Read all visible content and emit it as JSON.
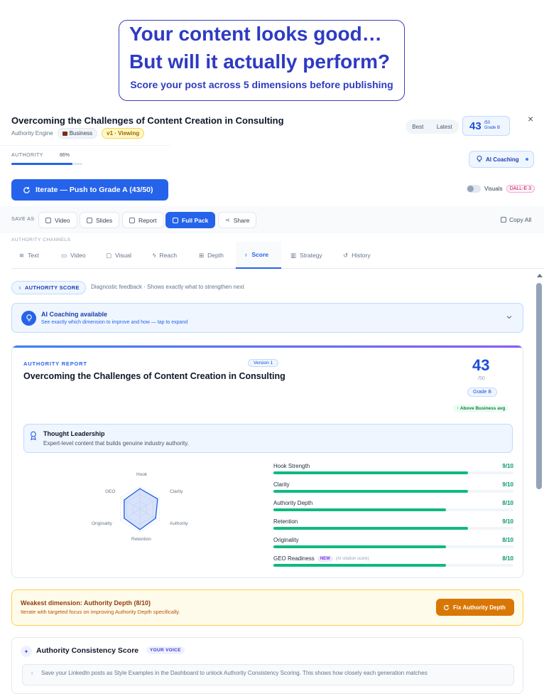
{
  "promo": {
    "line1": "Your content looks good…",
    "line2": "But will it actually perform?",
    "sub": "Score your post across 5 dimensions before publishing"
  },
  "header": {
    "title": "Overcoming the Challenges of Content Creation in Consulting",
    "engine": "Authority Engine",
    "category": "Business",
    "version_badge": "v1 · Viewing",
    "seg_best": "Best",
    "seg_latest": "Latest",
    "score": "43",
    "score_of": "/50",
    "grade": "Grade B",
    "close": "×"
  },
  "authority": {
    "label": "AUTHORITY",
    "percent": "86%",
    "fill_fraction": 0.86
  },
  "ai_coaching_button": "AI Coaching",
  "iterate_button": "Iterate — Push to Grade A (43/50)",
  "visuals": {
    "label": "Visuals",
    "badge": "DALL-E 3"
  },
  "save_as": {
    "label": "SAVE AS",
    "buttons": [
      "Video",
      "Slides",
      "Report",
      "Full Pack",
      "Share"
    ],
    "copy_all": "Copy All"
  },
  "channels": {
    "label": "AUTHORITY CHANNELS",
    "tabs": [
      "Text",
      "Video",
      "Visual",
      "Reach",
      "Depth",
      "Score",
      "Strategy",
      "History"
    ],
    "active": "Score"
  },
  "score_section": {
    "chip": "AUTHORITY SCORE",
    "description": "Diagnostic feedback · Shows exactly what to strengthen next"
  },
  "ai_box": {
    "title": "AI Coaching available",
    "sub": "See exactly which dimension to improve and how — tap to expand"
  },
  "report": {
    "label": "AUTHORITY REPORT",
    "version": "Version 1",
    "title": "Overcoming the Challenges of Content Creation in Consulting",
    "score": "43",
    "out_of": "/50",
    "grade": "Grade B",
    "above": "↑ Above Business avg",
    "level_title": "Thought Leadership",
    "level_sub": "Expert-level content that builds genuine industry authority.",
    "radar_labels": [
      "Hook",
      "Clarity",
      "Authority",
      "Retention",
      "Originality",
      "GEO"
    ],
    "radar_values": [
      9,
      9,
      8,
      9,
      8,
      8
    ],
    "radar_max": 10,
    "metrics": [
      {
        "name": "Hook Strength",
        "value": "9/10",
        "score": 9
      },
      {
        "name": "Clarity",
        "value": "9/10",
        "score": 9
      },
      {
        "name": "Authority Depth",
        "value": "8/10",
        "score": 8
      },
      {
        "name": "Retention",
        "value": "9/10",
        "score": 9
      },
      {
        "name": "Originality",
        "value": "8/10",
        "score": 8
      },
      {
        "name": "GEO Readiness",
        "value": "8/10",
        "score": 8,
        "badge": "NEW",
        "note": "(AI citation score)"
      }
    ]
  },
  "weakest": {
    "title": "Weakest dimension: Authority Depth (8/10)",
    "sub": "Iterate with targeted focus on improving Authority Depth specifically.",
    "button": "Fix Authority Depth"
  },
  "consistency": {
    "title": "Authority Consistency Score",
    "badge": "YOUR VOICE",
    "note": "Save your LinkedIn posts as Style Examples in the Dashboard to unlock Authority Consistency Scoring. This shows how closely each generation matches"
  },
  "colors": {
    "accent": "#2563eb",
    "success": "#10b981",
    "warning": "#d97706",
    "promo": "#2e3bc2"
  }
}
